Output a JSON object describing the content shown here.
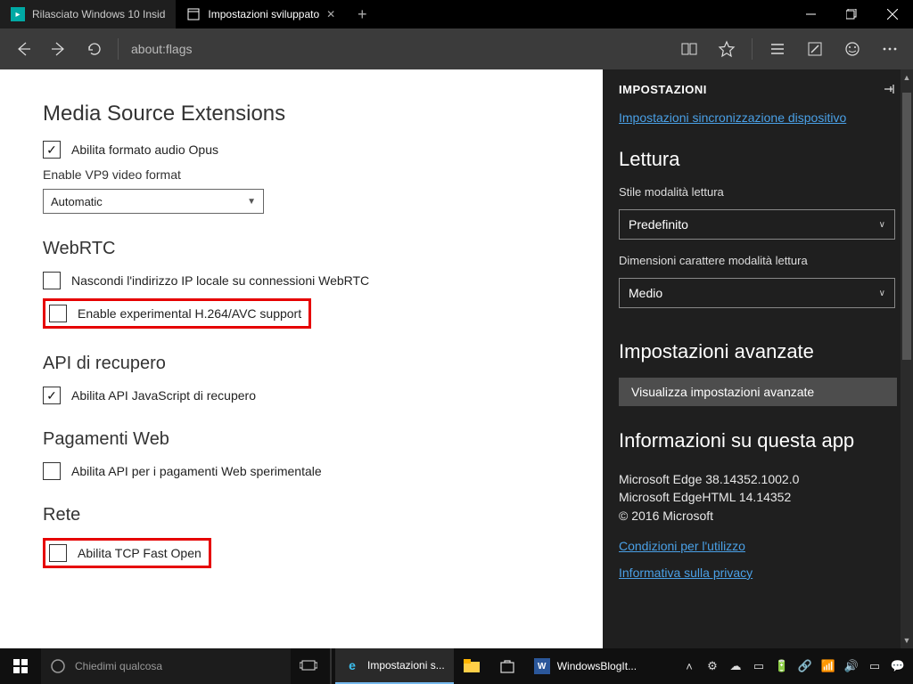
{
  "titlebar": {
    "tabs": [
      {
        "label": "Rilasciato Windows 10 Insid",
        "active": false
      },
      {
        "label": "Impostazioni sviluppato",
        "active": true
      }
    ]
  },
  "toolbar": {
    "address": "about:flags"
  },
  "flags": {
    "section_mse": "Media Source Extensions",
    "opus": "Abilita formato audio Opus",
    "vp9_label": "Enable VP9 video format",
    "vp9_value": "Automatic",
    "section_webrtc": "WebRTC",
    "webrtc_hide_ip": "Nascondi l'indirizzo IP locale su connessioni WebRTC",
    "webrtc_h264": "Enable experimental H.264/AVC support",
    "section_api": "API di recupero",
    "api_fetch": "Abilita API JavaScript di recupero",
    "section_pay": "Pagamenti Web",
    "pay_api": "Abilita API per i pagamenti Web sperimentale",
    "section_net": "Rete",
    "tcp_fast": "Abilita TCP Fast Open"
  },
  "pane": {
    "title": "IMPOSTAZIONI",
    "sync_link": "Impostazioni sincronizzazione dispositivo",
    "reading_title": "Lettura",
    "reading_style_label": "Stile modalità lettura",
    "reading_style_value": "Predefinito",
    "reading_size_label": "Dimensioni carattere modalità lettura",
    "reading_size_value": "Medio",
    "adv_title": "Impostazioni avanzate",
    "adv_button": "Visualizza impostazioni avanzate",
    "about_title": "Informazioni su questa app",
    "about_line1": "Microsoft Edge 38.14352.1002.0",
    "about_line2": "Microsoft EdgeHTML 14.14352",
    "about_line3": "© 2016 Microsoft",
    "terms": "Condizioni per l'utilizzo",
    "privacy": "Informativa sulla privacy"
  },
  "taskbar": {
    "search_placeholder": "Chiedimi qualcosa",
    "app1": "Impostazioni s...",
    "app2": "WindowsBlogIt..."
  }
}
